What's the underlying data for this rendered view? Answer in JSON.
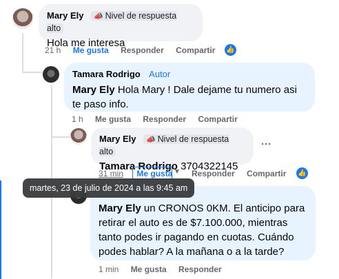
{
  "comment1": {
    "author": "Mary Ely",
    "badge": "Nivel de respuesta alto",
    "text": "Hola me interesa",
    "time": "21 h",
    "like": "Me gusta",
    "reply": "Responder",
    "share": "Compartir"
  },
  "comment2": {
    "author": "Tamara Rodrigo",
    "tag": "Autor",
    "mention": "Mary Ely",
    "text": " Hola Mary ! Dale dejame tu numero asi te paso info.",
    "time": "1 h",
    "like": "Me gusta",
    "reply": "Responder",
    "share": "Compartir"
  },
  "comment3": {
    "author": "Mary Ely",
    "badge": "Nivel de respuesta alto",
    "mention": "Tamara Rodrigo",
    "text": " 3704322145",
    "more": "···",
    "time": "31 min",
    "like": "Me gusta",
    "reply": "Responder",
    "share": "Compartir"
  },
  "comment4": {
    "mention": "Mary Ely",
    "text": " un CRONOS 0KM. El anticipo para retirar el auto es de $7.100.000, mientras tanto podes ir pagando en cuotas. Cuándo podes hablar? A la mañana o a la tarde?",
    "time": "1 min",
    "like": "Me gusta",
    "reply": "Responder"
  },
  "tooltip": "martes, 23 de julio de 2024 a las 9:45 am",
  "icons": {
    "badge": "megaphone-icon",
    "like": "thumbs-up-icon",
    "more": "more-options-icon",
    "caret": "caret-down-icon"
  },
  "colors": {
    "accent": "#1877f2",
    "bubble": "#f0f2f5",
    "author_bubble": "#e7f3ff"
  }
}
